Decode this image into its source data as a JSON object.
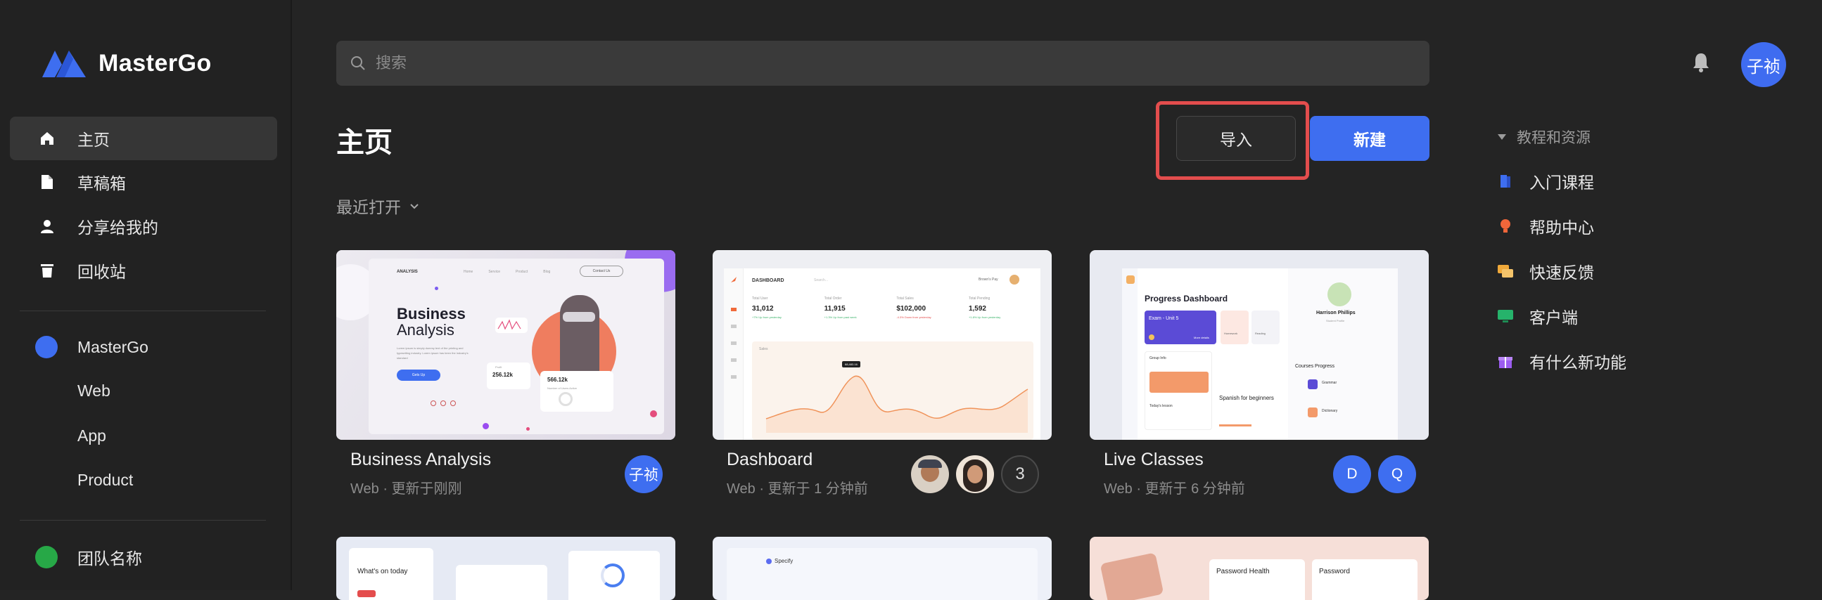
{
  "app": {
    "name": "MasterGo"
  },
  "sidebar": {
    "nav": [
      {
        "label": "主页",
        "icon": "home-icon"
      },
      {
        "label": "草稿箱",
        "icon": "file-icon"
      },
      {
        "label": "分享给我的",
        "icon": "user-icon"
      },
      {
        "label": "回收站",
        "icon": "trash-icon"
      }
    ],
    "team1": {
      "label": "MasterGo",
      "color": "#3e6ef0"
    },
    "sub_items": [
      "Web",
      "App",
      "Product"
    ],
    "team2": {
      "label": "团队名称",
      "color": "#27a847"
    }
  },
  "search": {
    "placeholder": "搜索"
  },
  "user": {
    "avatar_text": "子祯"
  },
  "main": {
    "title": "主页",
    "import_label": "导入",
    "new_label": "新建",
    "recent_label": "最近打开"
  },
  "cards": [
    {
      "title": "Business Analysis",
      "meta": "Web · 更新于刚刚",
      "avatars": [
        "子祯"
      ],
      "thumb": {
        "brand": "ANALYSIS",
        "nav": [
          "Home",
          "Service",
          "Product",
          "Blog"
        ],
        "contact": "Contact Us",
        "h1a": "Business",
        "h1b": "Analysis",
        "body": "Lorem ipsum is simply dummy text of the printing and typesetting industry. Lorem ipsum has been the industry's standard",
        "cta": "Gets Up",
        "stat1_label": "Profit",
        "stat1_value": "256.12k",
        "stat2_value": "566.12k",
        "stat2_label": "Number of Users Active"
      }
    },
    {
      "title": "Dashboard",
      "meta": "Web · 更新于 1 分钟前",
      "avatars_count": "3",
      "thumb": {
        "title": "DASHBOARD",
        "search": "Search...",
        "user": "Brown's Pay",
        "stats": [
          {
            "label": "Total User",
            "value": "31,012",
            "note": "+7% Up from yesterday"
          },
          {
            "label": "Total Order",
            "value": "11,915",
            "note": "+1.3% Up from past week"
          },
          {
            "label": "Total Sales",
            "value": "$102,000",
            "note": "-4.3% Down from yesterday"
          },
          {
            "label": "Total Pending",
            "value": "1,592",
            "note": "+1.8% Up from yesterday"
          }
        ],
        "chart_title": "Sales",
        "tooltip": "68,483.16"
      }
    },
    {
      "title": "Live Classes",
      "meta": "Web · 更新于 6 分钟前",
      "avatars": [
        "D",
        "Q"
      ],
      "thumb": {
        "title": "Progress Dashboard",
        "exam": "Exam - Unit 5",
        "more": "More details",
        "chip1": "Homework",
        "chip2": "Reading",
        "name": "Harrison Phillips",
        "role": "Student Profile",
        "group": "Group Info",
        "todays": "Today's lesson",
        "course": "Spanish for beginners",
        "courses_progress": "Courses Progress",
        "cp1": "Grammar",
        "cp2": "Dictionary"
      }
    }
  ],
  "bottom_cards": [
    {
      "label": "What's on today"
    },
    {
      "label": "Specify"
    },
    {
      "labels": [
        "Password Health",
        "Password"
      ]
    }
  ],
  "resources": {
    "header": "教程和资源",
    "items": [
      {
        "label": "入门课程",
        "color": "#3e6ef0",
        "icon": "book-icon"
      },
      {
        "label": "帮助中心",
        "color": "#f0663a",
        "icon": "bulb-icon"
      },
      {
        "label": "快速反馈",
        "color": "#f0a93a",
        "icon": "chat-icon"
      },
      {
        "label": "客户端",
        "color": "#26b36b",
        "icon": "monitor-icon"
      },
      {
        "label": "有什么新功能",
        "color": "#9b5cf0",
        "icon": "gift-icon"
      }
    ]
  }
}
